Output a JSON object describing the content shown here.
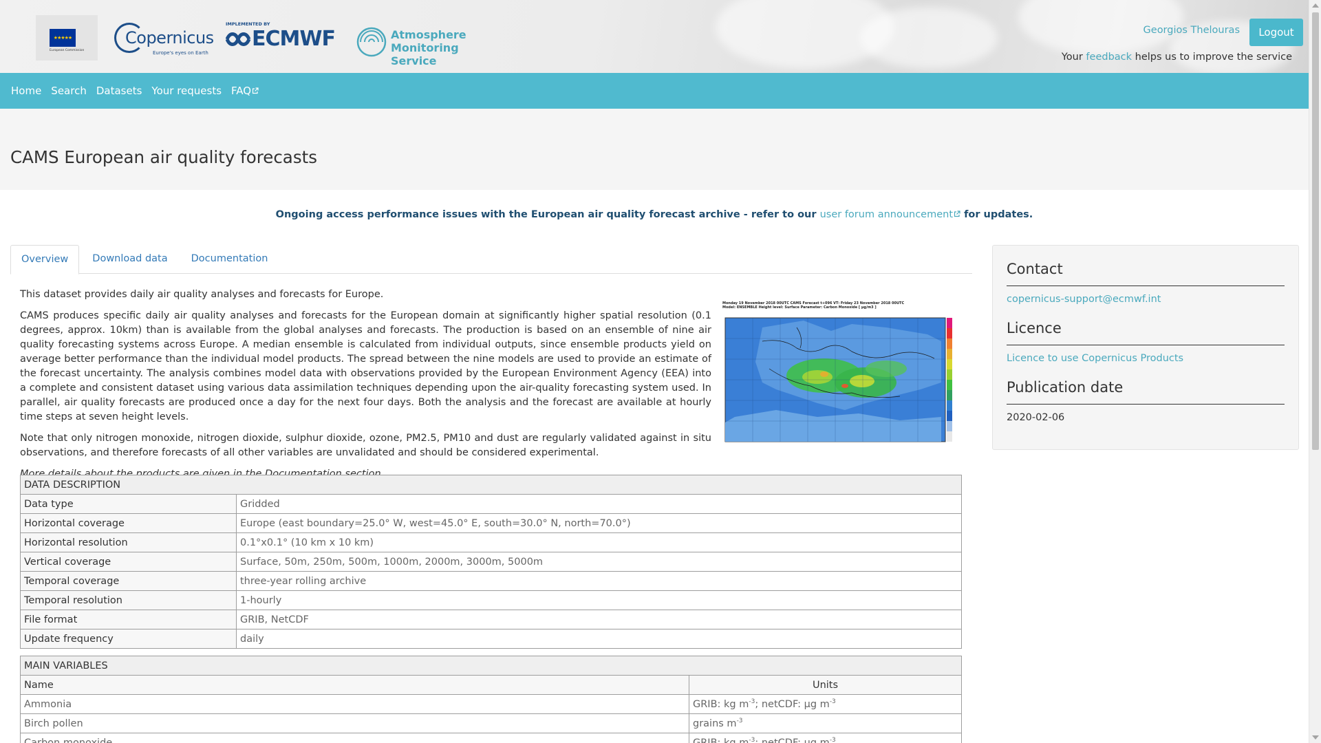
{
  "header": {
    "eu_logo_text": "European Commission",
    "copernicus_text": "Copernicus",
    "copernicus_tagline": "Europe's eyes on Earth",
    "implemented_by": "IMPLEMENTED BY",
    "ecmwf_text": "ECMWF",
    "ams_line1": "Atmosphere",
    "ams_line2": "Monitoring Service",
    "user_name": "Georgios Thelouras",
    "logout_label": "Logout",
    "feedback_prefix": "Your ",
    "feedback_link": "feedback",
    "feedback_suffix": " helps us to improve the service"
  },
  "nav": {
    "home": "Home",
    "search": "Search",
    "datasets": "Datasets",
    "requests": "Your requests",
    "faq": "FAQ"
  },
  "page_title": "CAMS European air quality forecasts",
  "announcement": {
    "prefix": "Ongoing access performance issues with the European air quality forecast archive - refer to our ",
    "link": "user forum announcement",
    "suffix": " for updates."
  },
  "tabs": {
    "overview": "Overview",
    "download": "Download data",
    "documentation": "Documentation"
  },
  "overview": {
    "p1": "This dataset provides daily air quality analyses and forecasts for Europe.",
    "p2": "CAMS produces specific daily air quality analyses and forecasts for the European domain at significantly higher spatial resolution (0.1 degrees, approx. 10km) than is available from the global analyses and forecasts. The production is based on an ensemble of nine air quality forecasting systems across Europe. A median ensemble is calculated from individual outputs, since ensemble products yield on average better performance than the individual model products. The spread between the nine models are used to provide an estimate of the forecast uncertainty. The analysis combines model data with observations provided by the European Environment Agency (EEA) into a complete and consistent dataset using various data assimilation techniques depending upon the air-quality forecasting system used. In parallel, air quality forecasts are produced once a day for the next four days. Both the analysis and the forecast are available at hourly time steps at seven height levels.",
    "p3": "Note that only nitrogen monoxide, nitrogen dioxide, sulphur dioxide, ozone, PM2.5, PM10 and dust are regularly validated against in situ observations, and therefore forecasts of all other variables are unvalidated and should be considered experimental.",
    "p4": "More details about the products are given in the Documentation section.",
    "map_title1": "Monday 19 November 2018 00UTC CAMS Forecast t+096 VT: Friday 23 November 2018 00UTC",
    "map_title2": "Model: ENSEMBLE  Height level: Surface  Parameter: Carbon Monoxide [ µg/m3 ]"
  },
  "data_description": {
    "caption": "DATA DESCRIPTION",
    "rows": [
      {
        "label": "Data type",
        "value": "Gridded"
      },
      {
        "label": "Horizontal coverage",
        "value": "Europe (east boundary=25.0° W, west=45.0° E, south=30.0° N, north=70.0°)"
      },
      {
        "label": "Horizontal resolution",
        "value": "0.1°x0.1° (10 km x 10 km)"
      },
      {
        "label": "Vertical coverage",
        "value": "Surface, 50m, 250m, 500m, 1000m, 2000m, 3000m, 5000m"
      },
      {
        "label": "Temporal coverage",
        "value": "three-year rolling archive"
      },
      {
        "label": "Temporal resolution",
        "value": "1-hourly"
      },
      {
        "label": "File format",
        "value": "GRIB, NetCDF"
      },
      {
        "label": "Update frequency",
        "value": "daily"
      }
    ]
  },
  "main_variables": {
    "caption": "MAIN VARIABLES",
    "col_name": "Name",
    "col_units": "Units",
    "rows": [
      {
        "name": "Ammonia",
        "units_a": "GRIB: kg m",
        "units_b": "; netCDF: µg m"
      },
      {
        "name": "Birch pollen",
        "units_a": "grains m",
        "units_b": ""
      },
      {
        "name": "Carbon monoxide",
        "units_a": "GRIB: kg m",
        "units_b": "; netCDF: µg m"
      }
    ]
  },
  "sidebar": {
    "contact_heading": "Contact",
    "contact_email": "copernicus-support@ecmwf.int",
    "licence_heading": "Licence",
    "licence_link": "Licence to use Copernicus Products",
    "pubdate_heading": "Publication date",
    "pubdate_value": "2020-02-06"
  },
  "colors": {
    "accent": "#50bacf",
    "link": "#4aa9bd",
    "ecmwf_blue": "#1d4e89",
    "announce_text": "#1f4e70"
  }
}
